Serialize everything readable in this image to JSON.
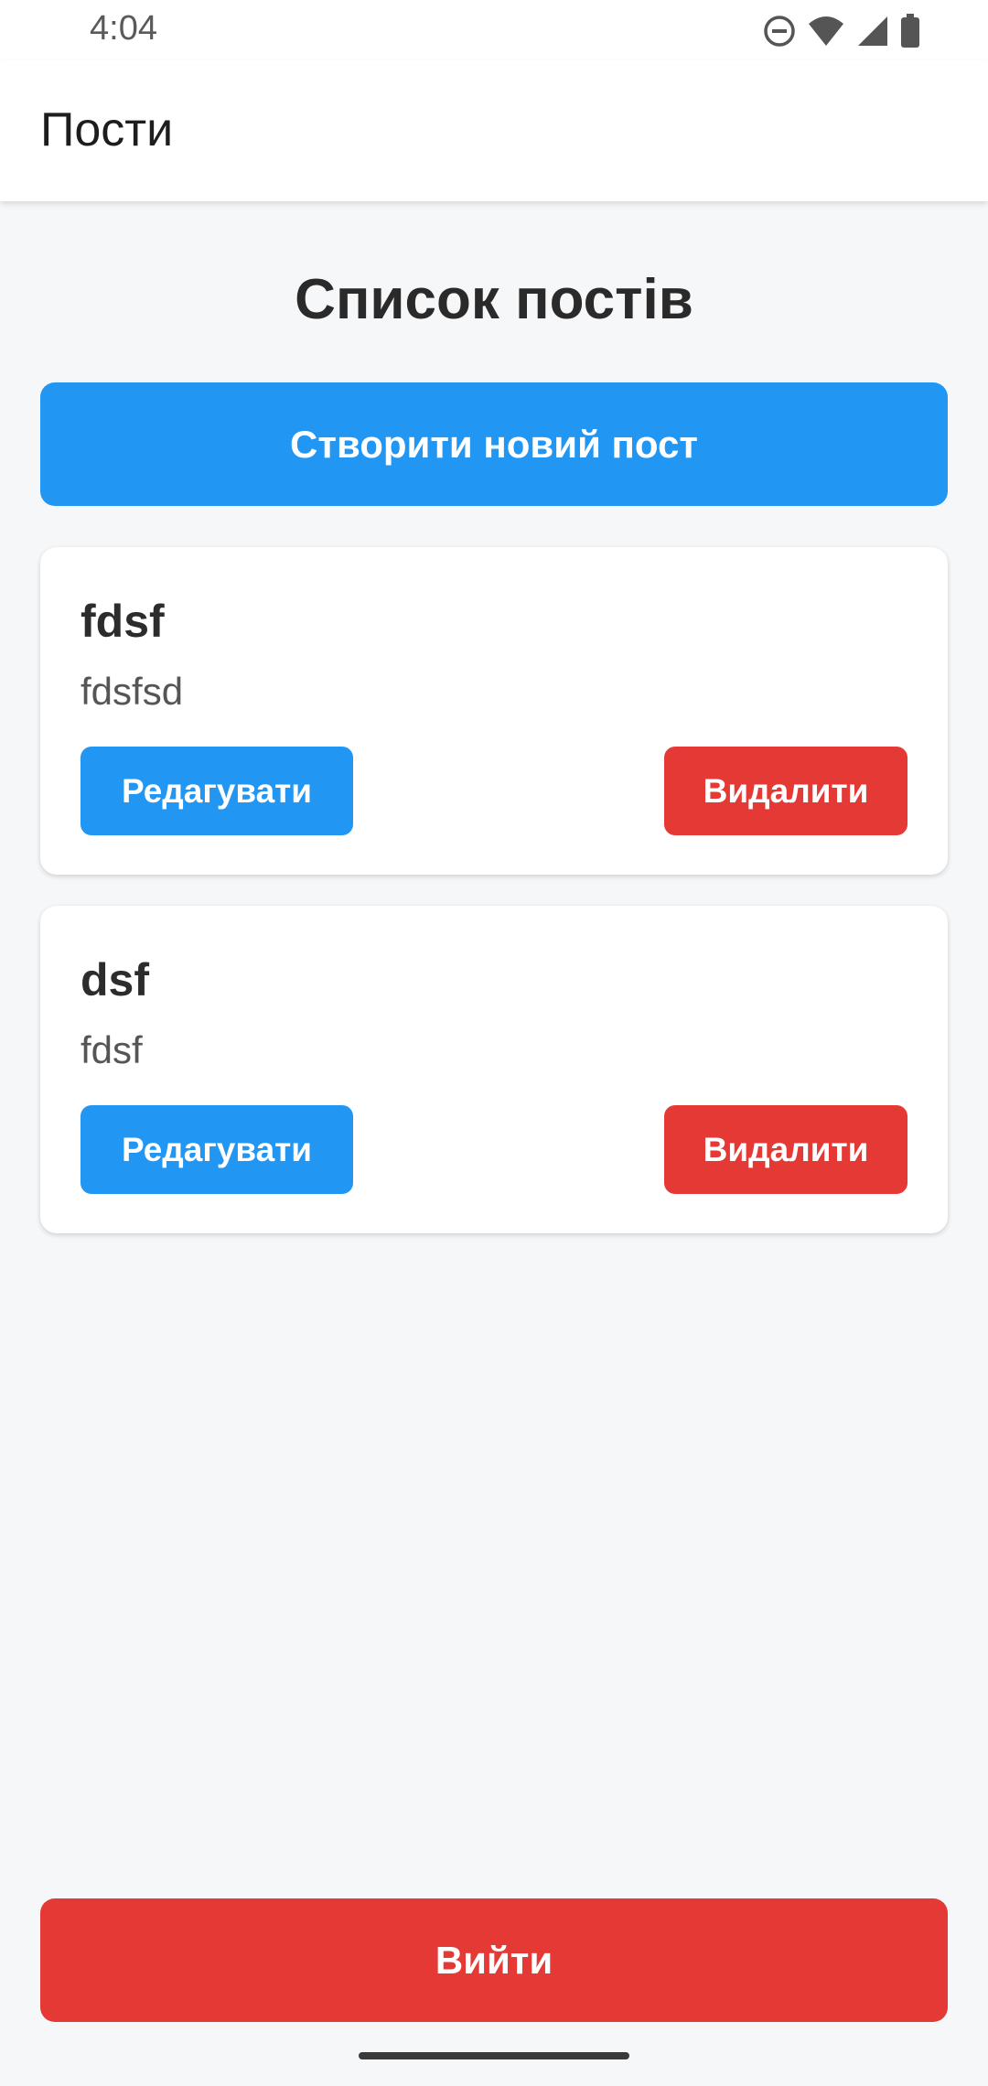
{
  "status_bar": {
    "time": "4:04",
    "icons": [
      "do-not-disturb-icon",
      "wifi-icon",
      "cellular-signal-icon",
      "battery-icon"
    ]
  },
  "app_bar": {
    "title": "Пости"
  },
  "page": {
    "heading": "Список постів",
    "create_button_label": "Створити новий пост"
  },
  "posts": [
    {
      "title": "fdsf",
      "body": "fdsfsd",
      "edit_label": "Редагувати",
      "delete_label": "Видалити"
    },
    {
      "title": "dsf",
      "body": "fdsf",
      "edit_label": "Редагувати",
      "delete_label": "Видалити"
    }
  ],
  "footer": {
    "logout_label": "Вийти"
  },
  "colors": {
    "primary": "#2196f3",
    "danger": "#e53935",
    "background": "#f6f7f9"
  }
}
